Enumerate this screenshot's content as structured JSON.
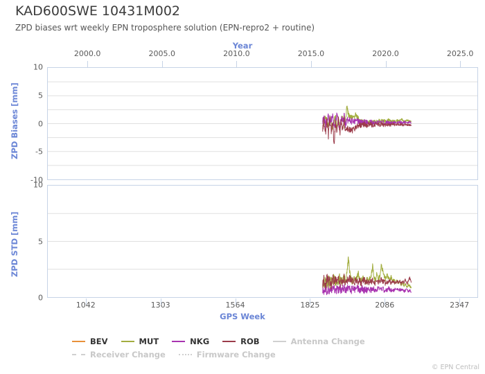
{
  "header": {
    "title": "KAD600SWE 10431M002",
    "subtitle": "ZPD biases wrt weekly EPN troposphere solution (EPN-repro2 + routine)"
  },
  "footer": {
    "copyright": "© EPN Central"
  },
  "colors": {
    "axis_label": "#6b86d6",
    "frame": "#c6d3e6",
    "grid": "#dfdfdf",
    "BEV": "#e8903a",
    "MUT": "#a2ad3f",
    "NKG": "#a833b0",
    "ROB": "#9b3b4a",
    "muted": "#d0d0d0"
  },
  "legend": {
    "items": [
      {
        "label": "BEV",
        "color": "#e8903a",
        "style": "solid",
        "muted": false
      },
      {
        "label": "MUT",
        "color": "#a2ad3f",
        "style": "solid",
        "muted": false
      },
      {
        "label": "NKG",
        "color": "#a833b0",
        "style": "solid",
        "muted": false
      },
      {
        "label": "ROB",
        "color": "#9b3b4a",
        "style": "solid",
        "muted": false
      },
      {
        "label": "Antenna Change",
        "color": "#d0d0d0",
        "style": "solid",
        "muted": true
      },
      {
        "label": "Receiver Change",
        "color": "#d0d0d0",
        "style": "dashed",
        "muted": true
      },
      {
        "label": "Firmware Change",
        "color": "#d0d0d0",
        "style": "dotted",
        "muted": true
      }
    ]
  },
  "chart_data": [
    {
      "id": "zpd-biases",
      "type": "line",
      "title": "ZPD biases wrt weekly EPN troposphere solution (EPN-repro2 + routine)",
      "ylabel": "ZPD Biases [mm]",
      "xlabel": "Year",
      "xlabel_position": "top",
      "grid": true,
      "legend_position": "bottom",
      "xlim": [
        907,
        2412
      ],
      "ylim": [
        -10,
        10
      ],
      "yticks": [
        10,
        5,
        0,
        -5,
        -10
      ],
      "ygrid_minor": [
        7.5,
        2.5,
        -2.5,
        -7.5
      ],
      "x_top_axis": {
        "label": "Year",
        "ticks": [
          2000.0,
          2005.0,
          2010.0,
          2015.0,
          2020.0,
          2025.0
        ],
        "tick_labels": [
          "2000.0",
          "2005.0",
          "2010.0",
          "2015.0",
          "2020.0",
          "2025.0"
        ],
        "lim": [
          1997.3,
          2026.2
        ]
      },
      "series": [
        {
          "name": "BEV",
          "color": "#e8903a",
          "x": [],
          "values": []
        },
        {
          "name": "MUT",
          "color": "#a2ad3f",
          "x": [
            1870,
            1875,
            1880,
            1885,
            1890,
            1895,
            1900,
            1905,
            1910,
            1915,
            1920,
            1925,
            1930,
            1935,
            1940,
            1945,
            1950,
            1955,
            1960,
            1965,
            1970,
            1975,
            1980,
            1985,
            1990,
            1995,
            2000,
            2005,
            2010,
            2015,
            2020,
            2025,
            2030,
            2035,
            2040,
            2045,
            2050,
            2055,
            2060,
            2065,
            2070,
            2075,
            2080,
            2085,
            2090,
            2095,
            2100,
            2105,
            2110,
            2115,
            2120,
            2125,
            2130,
            2135,
            2140,
            2145,
            2150,
            2155,
            2160,
            2165,
            2170,
            2175,
            2180
          ],
          "values": [
            0.9,
            -0.3,
            1.2,
            0.4,
            -0.6,
            0.8,
            0.1,
            -1.0,
            0.5,
            1.4,
            -0.2,
            0.6,
            -0.8,
            0.3,
            1.1,
            -0.4,
            0.7,
            2.9,
            1.6,
            1.4,
            1.2,
            1.5,
            1.3,
            1.7,
            1.1,
            0.9,
            0.5,
            0.3,
            0.4,
            0.2,
            0.3,
            0.1,
            0.2,
            0.3,
            0.1,
            0.2,
            0.4,
            0.2,
            0.3,
            0.5,
            0.4,
            0.6,
            0.4,
            0.5,
            0.3,
            0.4,
            0.6,
            0.5,
            0.3,
            0.4,
            0.5,
            0.4,
            0.6,
            0.4,
            0.5,
            0.9,
            0.6,
            0.4,
            0.5,
            0.7,
            0.5,
            0.4,
            0.3
          ]
        },
        {
          "name": "NKG",
          "color": "#a833b0",
          "x": [
            1870,
            1875,
            1880,
            1885,
            1890,
            1895,
            1900,
            1905,
            1910,
            1915,
            1920,
            1925,
            1930,
            1935,
            1940,
            1945,
            1950,
            1955,
            1960,
            1965,
            1970,
            1975,
            1980,
            1985,
            1990,
            1995,
            2000,
            2005,
            2010,
            2015,
            2020,
            2025,
            2030,
            2035,
            2040,
            2045,
            2050,
            2055,
            2060,
            2065,
            2070,
            2075,
            2080,
            2085,
            2090,
            2095,
            2100,
            2105,
            2110,
            2115,
            2120,
            2125,
            2130,
            2135,
            2140,
            2145,
            2150,
            2155,
            2160,
            2165,
            2170,
            2175,
            2180
          ],
          "values": [
            0.6,
            1.4,
            -0.5,
            0.9,
            1.8,
            -0.3,
            0.7,
            1.2,
            -0.7,
            0.4,
            1.5,
            0.2,
            -0.9,
            1.1,
            0.3,
            1.6,
            -0.4,
            0.8,
            0.5,
            0.6,
            0.4,
            0.5,
            0.3,
            0.4,
            0.5,
            0.3,
            0.4,
            0.3,
            0.2,
            0.3,
            0.2,
            0.3,
            0.1,
            0.2,
            0.3,
            0.2,
            0.1,
            0.2,
            0.3,
            0.2,
            0.1,
            0.2,
            0.3,
            0.1,
            0.2,
            0.3,
            0.2,
            0.1,
            0.2,
            0.3,
            0.2,
            0.3,
            0.1,
            0.2,
            0.3,
            0.2,
            0.1,
            0.3,
            0.2,
            0.1,
            0.2,
            0.3,
            0.2
          ]
        },
        {
          "name": "ROB",
          "color": "#9b3b4a",
          "x": [
            1870,
            1875,
            1880,
            1885,
            1890,
            1895,
            1900,
            1905,
            1910,
            1915,
            1920,
            1925,
            1930,
            1935,
            1940,
            1945,
            1950,
            1955,
            1960,
            1965,
            1970,
            1975,
            1980,
            1985,
            1990,
            1995,
            2000,
            2005,
            2010,
            2015,
            2020,
            2025,
            2030,
            2035,
            2040,
            2045,
            2050,
            2055,
            2060,
            2065,
            2070,
            2075,
            2080,
            2085,
            2090,
            2095,
            2100,
            2105,
            2110,
            2115,
            2120,
            2125,
            2130,
            2135,
            2140,
            2145,
            2150,
            2155,
            2160,
            2165,
            2170,
            2175,
            2180
          ],
          "values": [
            -0.8,
            0.5,
            -1.6,
            0.7,
            -2.1,
            1.0,
            -1.2,
            0.3,
            -4.1,
            0.6,
            -1.4,
            0.8,
            -1.9,
            0.4,
            -1.1,
            0.9,
            -1.5,
            -0.6,
            -1.3,
            -1.1,
            -1.4,
            -1.2,
            -0.9,
            -0.7,
            -0.5,
            -0.4,
            -0.3,
            -0.2,
            -0.3,
            -0.1,
            -0.2,
            -0.3,
            -0.2,
            -0.1,
            -0.2,
            -0.3,
            -0.1,
            -0.2,
            -0.1,
            -0.2,
            -0.3,
            -0.1,
            -0.2,
            -0.3,
            -0.2,
            -0.1,
            -0.2,
            -0.3,
            -0.2,
            -0.1,
            -0.2,
            -0.3,
            -0.2,
            -0.1,
            -0.2,
            -0.1,
            -0.3,
            -0.2,
            -0.1,
            -0.2,
            -0.3,
            -0.2,
            -0.4
          ]
        }
      ]
    },
    {
      "id": "zpd-std",
      "type": "line",
      "ylabel": "ZPD STD [mm]",
      "xlabel": "GPS Week",
      "xlabel_position": "bottom",
      "grid": true,
      "xlim": [
        907,
        2412
      ],
      "ylim": [
        0,
        10
      ],
      "yticks": [
        10,
        5,
        0
      ],
      "ygrid_minor": [
        7.5,
        2.5
      ],
      "xticks": [
        1042,
        1303,
        1564,
        1825,
        2086,
        2347
      ],
      "xtick_labels": [
        "1042",
        "1303",
        "1564",
        "1825",
        "2086",
        "2347"
      ],
      "series": [
        {
          "name": "BEV",
          "color": "#e8903a",
          "x": [],
          "values": []
        },
        {
          "name": "MUT",
          "color": "#a2ad3f",
          "x": [
            1870,
            1875,
            1880,
            1885,
            1890,
            1895,
            1900,
            1905,
            1910,
            1915,
            1920,
            1925,
            1930,
            1935,
            1940,
            1945,
            1950,
            1955,
            1960,
            1965,
            1970,
            1975,
            1980,
            1985,
            1990,
            1995,
            2000,
            2005,
            2010,
            2015,
            2020,
            2025,
            2030,
            2035,
            2040,
            2045,
            2050,
            2055,
            2060,
            2065,
            2070,
            2075,
            2080,
            2085,
            2090,
            2095,
            2100,
            2105,
            2110,
            2115,
            2120,
            2125,
            2130,
            2135,
            2140,
            2145,
            2150,
            2155,
            2160,
            2165,
            2170,
            2175,
            2180
          ],
          "values": [
            1.4,
            1.0,
            1.6,
            1.2,
            1.7,
            1.1,
            1.5,
            1.3,
            1.9,
            1.2,
            1.6,
            1.4,
            1.8,
            1.3,
            1.5,
            1.7,
            1.4,
            2.0,
            3.5,
            2.3,
            1.6,
            1.4,
            1.9,
            1.5,
            1.7,
            2.1,
            1.6,
            1.4,
            1.8,
            1.5,
            1.3,
            1.6,
            1.4,
            1.7,
            2.0,
            2.8,
            1.7,
            1.5,
            2.1,
            1.6,
            1.8,
            2.9,
            2.4,
            1.9,
            1.6,
            2.0,
            1.7,
            1.5,
            1.8,
            1.4,
            1.6,
            1.3,
            1.5,
            1.2,
            1.4,
            1.1,
            1.3,
            1.0,
            1.2,
            0.9,
            1.1,
            1.0,
            0.8
          ]
        },
        {
          "name": "NKG",
          "color": "#a833b0",
          "x": [
            1870,
            1875,
            1880,
            1885,
            1890,
            1895,
            1900,
            1905,
            1910,
            1915,
            1920,
            1925,
            1930,
            1935,
            1940,
            1945,
            1950,
            1955,
            1960,
            1965,
            1970,
            1975,
            1980,
            1985,
            1990,
            1995,
            2000,
            2005,
            2010,
            2015,
            2020,
            2025,
            2030,
            2035,
            2040,
            2045,
            2050,
            2055,
            2060,
            2065,
            2070,
            2075,
            2080,
            2085,
            2090,
            2095,
            2100,
            2105,
            2110,
            2115,
            2120,
            2125,
            2130,
            2135,
            2140,
            2145,
            2150,
            2155,
            2160,
            2165,
            2170,
            2175,
            2180
          ],
          "values": [
            0.7,
            0.5,
            0.8,
            0.6,
            0.9,
            0.5,
            0.7,
            0.6,
            0.8,
            0.5,
            0.7,
            0.6,
            0.9,
            0.6,
            0.7,
            0.8,
            0.6,
            0.7,
            0.9,
            0.7,
            0.6,
            0.8,
            0.7,
            0.6,
            0.8,
            0.7,
            0.6,
            0.7,
            0.8,
            0.6,
            0.7,
            0.6,
            0.8,
            0.7,
            0.6,
            0.8,
            0.7,
            0.6,
            0.7,
            0.8,
            0.6,
            0.7,
            0.8,
            0.6,
            0.7,
            0.6,
            0.8,
            0.7,
            0.6,
            0.7,
            0.6,
            0.8,
            0.7,
            0.6,
            0.7,
            0.6,
            0.7,
            0.5,
            0.6,
            0.7,
            0.5,
            0.6,
            0.5
          ]
        },
        {
          "name": "ROB",
          "color": "#9b3b4a",
          "x": [
            1870,
            1875,
            1880,
            1885,
            1890,
            1895,
            1900,
            1905,
            1910,
            1915,
            1920,
            1925,
            1930,
            1935,
            1940,
            1945,
            1950,
            1955,
            1960,
            1965,
            1970,
            1975,
            1980,
            1985,
            1990,
            1995,
            2000,
            2005,
            2010,
            2015,
            2020,
            2025,
            2030,
            2035,
            2040,
            2045,
            2050,
            2055,
            2060,
            2065,
            2070,
            2075,
            2080,
            2085,
            2090,
            2095,
            2100,
            2105,
            2110,
            2115,
            2120,
            2125,
            2130,
            2135,
            2140,
            2145,
            2150,
            2155,
            2160,
            2165,
            2170,
            2175,
            2180
          ],
          "values": [
            1.2,
            1.6,
            1.0,
            1.8,
            1.3,
            1.5,
            1.1,
            1.7,
            1.2,
            1.9,
            1.4,
            1.6,
            1.1,
            1.5,
            1.3,
            1.8,
            1.2,
            1.6,
            1.4,
            1.7,
            1.3,
            1.5,
            1.2,
            1.6,
            1.4,
            1.3,
            1.5,
            1.2,
            1.4,
            1.6,
            1.3,
            1.5,
            1.2,
            1.4,
            1.3,
            1.6,
            1.4,
            1.2,
            1.5,
            1.3,
            1.4,
            1.6,
            1.3,
            1.5,
            1.2,
            1.4,
            1.3,
            1.5,
            1.2,
            1.4,
            1.3,
            1.2,
            1.4,
            1.3,
            1.5,
            1.2,
            1.4,
            1.3,
            1.6,
            1.2,
            1.4,
            1.8,
            1.3
          ]
        }
      ]
    }
  ]
}
